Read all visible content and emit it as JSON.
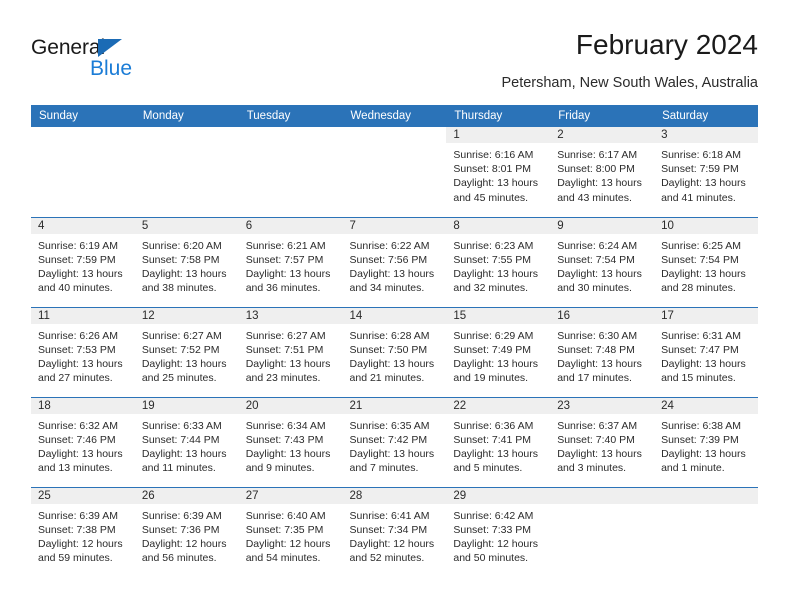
{
  "brand": {
    "name_top": "General",
    "name_bottom": "Blue",
    "triangle_color": "#1b6bb5",
    "blue_color": "#1b7cd6"
  },
  "header": {
    "title": "February 2024",
    "subtitle": "Petersham, New South Wales, Australia"
  },
  "theme": {
    "header_blue": "#2b73b8",
    "daynum_band": "#efefef",
    "text": "#2b2b2b"
  },
  "weekday_headers": [
    "Sunday",
    "Monday",
    "Tuesday",
    "Wednesday",
    "Thursday",
    "Friday",
    "Saturday"
  ],
  "weeks": [
    [
      {
        "day": "",
        "empty": true
      },
      {
        "day": "",
        "empty": true
      },
      {
        "day": "",
        "empty": true
      },
      {
        "day": "",
        "empty": true
      },
      {
        "day": "1",
        "sunrise": "Sunrise: 6:16 AM",
        "sunset": "Sunset: 8:01 PM",
        "daylight1": "Daylight: 13 hours",
        "daylight2": "and 45 minutes."
      },
      {
        "day": "2",
        "sunrise": "Sunrise: 6:17 AM",
        "sunset": "Sunset: 8:00 PM",
        "daylight1": "Daylight: 13 hours",
        "daylight2": "and 43 minutes."
      },
      {
        "day": "3",
        "sunrise": "Sunrise: 6:18 AM",
        "sunset": "Sunset: 7:59 PM",
        "daylight1": "Daylight: 13 hours",
        "daylight2": "and 41 minutes."
      }
    ],
    [
      {
        "day": "4",
        "sunrise": "Sunrise: 6:19 AM",
        "sunset": "Sunset: 7:59 PM",
        "daylight1": "Daylight: 13 hours",
        "daylight2": "and 40 minutes."
      },
      {
        "day": "5",
        "sunrise": "Sunrise: 6:20 AM",
        "sunset": "Sunset: 7:58 PM",
        "daylight1": "Daylight: 13 hours",
        "daylight2": "and 38 minutes."
      },
      {
        "day": "6",
        "sunrise": "Sunrise: 6:21 AM",
        "sunset": "Sunset: 7:57 PM",
        "daylight1": "Daylight: 13 hours",
        "daylight2": "and 36 minutes."
      },
      {
        "day": "7",
        "sunrise": "Sunrise: 6:22 AM",
        "sunset": "Sunset: 7:56 PM",
        "daylight1": "Daylight: 13 hours",
        "daylight2": "and 34 minutes."
      },
      {
        "day": "8",
        "sunrise": "Sunrise: 6:23 AM",
        "sunset": "Sunset: 7:55 PM",
        "daylight1": "Daylight: 13 hours",
        "daylight2": "and 32 minutes."
      },
      {
        "day": "9",
        "sunrise": "Sunrise: 6:24 AM",
        "sunset": "Sunset: 7:54 PM",
        "daylight1": "Daylight: 13 hours",
        "daylight2": "and 30 minutes."
      },
      {
        "day": "10",
        "sunrise": "Sunrise: 6:25 AM",
        "sunset": "Sunset: 7:54 PM",
        "daylight1": "Daylight: 13 hours",
        "daylight2": "and 28 minutes."
      }
    ],
    [
      {
        "day": "11",
        "sunrise": "Sunrise: 6:26 AM",
        "sunset": "Sunset: 7:53 PM",
        "daylight1": "Daylight: 13 hours",
        "daylight2": "and 27 minutes."
      },
      {
        "day": "12",
        "sunrise": "Sunrise: 6:27 AM",
        "sunset": "Sunset: 7:52 PM",
        "daylight1": "Daylight: 13 hours",
        "daylight2": "and 25 minutes."
      },
      {
        "day": "13",
        "sunrise": "Sunrise: 6:27 AM",
        "sunset": "Sunset: 7:51 PM",
        "daylight1": "Daylight: 13 hours",
        "daylight2": "and 23 minutes."
      },
      {
        "day": "14",
        "sunrise": "Sunrise: 6:28 AM",
        "sunset": "Sunset: 7:50 PM",
        "daylight1": "Daylight: 13 hours",
        "daylight2": "and 21 minutes."
      },
      {
        "day": "15",
        "sunrise": "Sunrise: 6:29 AM",
        "sunset": "Sunset: 7:49 PM",
        "daylight1": "Daylight: 13 hours",
        "daylight2": "and 19 minutes."
      },
      {
        "day": "16",
        "sunrise": "Sunrise: 6:30 AM",
        "sunset": "Sunset: 7:48 PM",
        "daylight1": "Daylight: 13 hours",
        "daylight2": "and 17 minutes."
      },
      {
        "day": "17",
        "sunrise": "Sunrise: 6:31 AM",
        "sunset": "Sunset: 7:47 PM",
        "daylight1": "Daylight: 13 hours",
        "daylight2": "and 15 minutes."
      }
    ],
    [
      {
        "day": "18",
        "sunrise": "Sunrise: 6:32 AM",
        "sunset": "Sunset: 7:46 PM",
        "daylight1": "Daylight: 13 hours",
        "daylight2": "and 13 minutes."
      },
      {
        "day": "19",
        "sunrise": "Sunrise: 6:33 AM",
        "sunset": "Sunset: 7:44 PM",
        "daylight1": "Daylight: 13 hours",
        "daylight2": "and 11 minutes."
      },
      {
        "day": "20",
        "sunrise": "Sunrise: 6:34 AM",
        "sunset": "Sunset: 7:43 PM",
        "daylight1": "Daylight: 13 hours",
        "daylight2": "and 9 minutes."
      },
      {
        "day": "21",
        "sunrise": "Sunrise: 6:35 AM",
        "sunset": "Sunset: 7:42 PM",
        "daylight1": "Daylight: 13 hours",
        "daylight2": "and 7 minutes."
      },
      {
        "day": "22",
        "sunrise": "Sunrise: 6:36 AM",
        "sunset": "Sunset: 7:41 PM",
        "daylight1": "Daylight: 13 hours",
        "daylight2": "and 5 minutes."
      },
      {
        "day": "23",
        "sunrise": "Sunrise: 6:37 AM",
        "sunset": "Sunset: 7:40 PM",
        "daylight1": "Daylight: 13 hours",
        "daylight2": "and 3 minutes."
      },
      {
        "day": "24",
        "sunrise": "Sunrise: 6:38 AM",
        "sunset": "Sunset: 7:39 PM",
        "daylight1": "Daylight: 13 hours",
        "daylight2": "and 1 minute."
      }
    ],
    [
      {
        "day": "25",
        "sunrise": "Sunrise: 6:39 AM",
        "sunset": "Sunset: 7:38 PM",
        "daylight1": "Daylight: 12 hours",
        "daylight2": "and 59 minutes."
      },
      {
        "day": "26",
        "sunrise": "Sunrise: 6:39 AM",
        "sunset": "Sunset: 7:36 PM",
        "daylight1": "Daylight: 12 hours",
        "daylight2": "and 56 minutes."
      },
      {
        "day": "27",
        "sunrise": "Sunrise: 6:40 AM",
        "sunset": "Sunset: 7:35 PM",
        "daylight1": "Daylight: 12 hours",
        "daylight2": "and 54 minutes."
      },
      {
        "day": "28",
        "sunrise": "Sunrise: 6:41 AM",
        "sunset": "Sunset: 7:34 PM",
        "daylight1": "Daylight: 12 hours",
        "daylight2": "and 52 minutes."
      },
      {
        "day": "29",
        "sunrise": "Sunrise: 6:42 AM",
        "sunset": "Sunset: 7:33 PM",
        "daylight1": "Daylight: 12 hours",
        "daylight2": "and 50 minutes."
      },
      {
        "day": "",
        "empty": true,
        "blankrow": true
      },
      {
        "day": "",
        "empty": true,
        "blankrow": true
      }
    ]
  ]
}
